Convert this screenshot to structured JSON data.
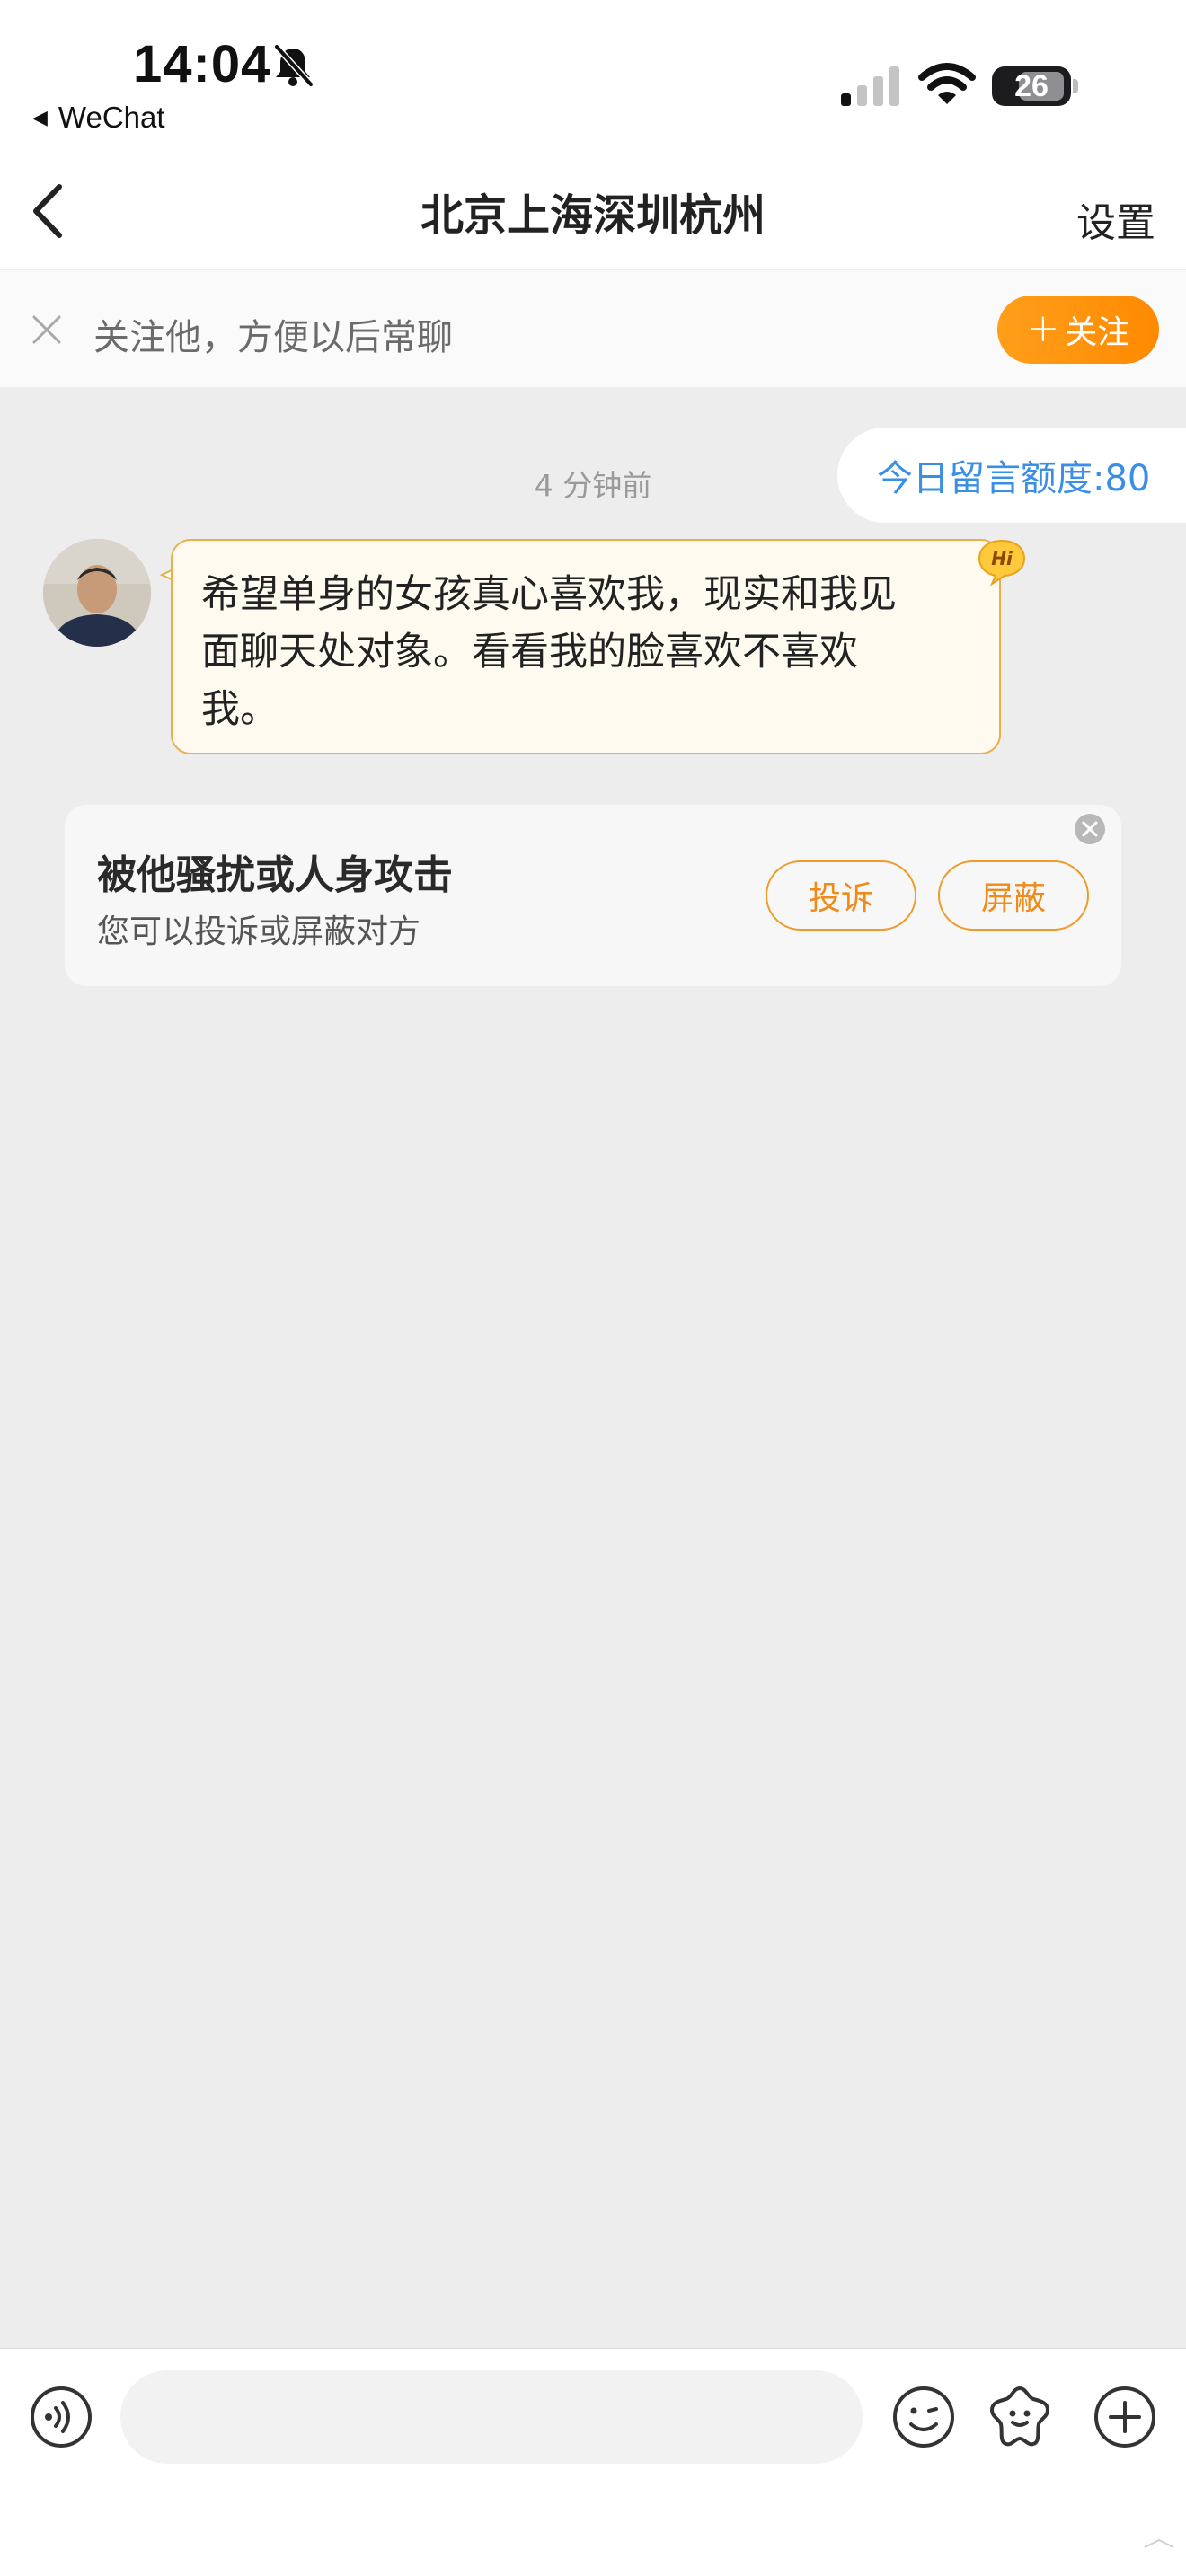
{
  "status_bar": {
    "time": "14:04",
    "back_app": "WeChat",
    "battery": "26"
  },
  "header": {
    "title": "北京上海深圳杭州",
    "settings_label": "设置"
  },
  "follow_banner": {
    "text": "关注他，方便以后常聊",
    "button_label": "关注"
  },
  "chat": {
    "quota": "今日留言额度:80",
    "timestamp": "4 分钟前",
    "message": {
      "line1": "希望单身的女孩真心喜欢我，现实和我见",
      "line2": "面聊天处对象。看看我的脸喜欢不喜欢",
      "line3": "我。",
      "badge": "Hi"
    },
    "report_card": {
      "title": "被他骚扰或人身攻击",
      "subtitle": "您可以投诉或屏蔽对方",
      "complain_label": "投诉",
      "block_label": "屏蔽"
    }
  },
  "input_bar": {
    "value": "",
    "placeholder": ""
  },
  "colors": {
    "accent_orange": "#ff8a00",
    "quota_blue": "#3a8ee6",
    "bubble_border": "#e7b04a",
    "bubble_bg": "#fffaf0",
    "chat_bg": "#ededed"
  }
}
